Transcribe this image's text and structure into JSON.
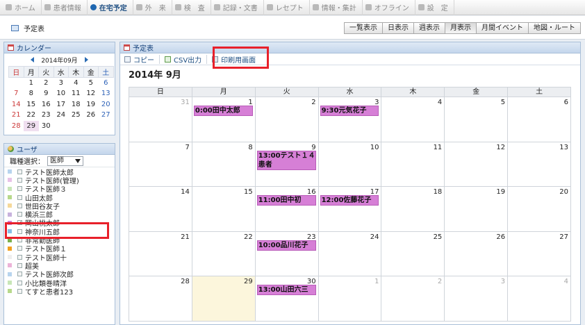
{
  "nav": [
    {
      "label": "ホーム",
      "icon": "home-icon",
      "active": false
    },
    {
      "label": "患者情報",
      "icon": "patient-icon",
      "active": false
    },
    {
      "label": "在宅予定",
      "icon": "clock-icon",
      "active": true
    },
    {
      "label": "外　来",
      "icon": "outpatient-icon",
      "active": false
    },
    {
      "label": "検　査",
      "icon": "test-icon",
      "active": false
    },
    {
      "label": "記録・文書",
      "icon": "document-icon",
      "active": false
    },
    {
      "label": "レセプト",
      "icon": "receipt-icon",
      "active": false
    },
    {
      "label": "情報・集計",
      "icon": "chart-icon",
      "active": false
    },
    {
      "label": "オフライン",
      "icon": "offline-icon",
      "active": false
    },
    {
      "label": "設　定",
      "icon": "settings-icon",
      "active": false
    }
  ],
  "page_title": "予定表",
  "view_buttons": [
    {
      "label": "一覧表示",
      "selected": false
    },
    {
      "label": "日表示",
      "selected": false
    },
    {
      "label": "週表示",
      "selected": false
    },
    {
      "label": "月表示",
      "selected": true
    },
    {
      "label": "月間イベント",
      "selected": false
    },
    {
      "label": "地図・ルート",
      "selected": false
    }
  ],
  "calendar_panel": {
    "title": "カレンダー",
    "month_label": "2014年09月",
    "weekdays": [
      "日",
      "月",
      "火",
      "水",
      "木",
      "金",
      "土"
    ],
    "weeks": [
      [
        "",
        "1",
        "2",
        "3",
        "4",
        "5",
        "6"
      ],
      [
        "7",
        "8",
        "9",
        "10",
        "11",
        "12",
        "13"
      ],
      [
        "14",
        "15",
        "16",
        "17",
        "18",
        "19",
        "20"
      ],
      [
        "21",
        "22",
        "23",
        "24",
        "25",
        "26",
        "27"
      ],
      [
        "28",
        "29",
        "30",
        "",
        "",
        "",
        ""
      ]
    ],
    "selected_day": "29"
  },
  "user_panel": {
    "title": "ユーザ",
    "filter_label": "職種選択：",
    "filter_value": "医師",
    "users": [
      {
        "name": "テスト医師太郎",
        "color": "#b8d4ee",
        "checked": false
      },
      {
        "name": "テスト医師(管理)",
        "color": "#e8c3e8",
        "checked": false
      },
      {
        "name": "テスト医師３",
        "color": "#c8e6b8",
        "checked": false
      },
      {
        "name": "山田太郎",
        "color": "#b7d98b",
        "checked": false
      },
      {
        "name": "世田谷友子",
        "color": "#f5d99a",
        "checked": false
      },
      {
        "name": "横浜三郎",
        "color": "#c7b2dd",
        "checked": false
      },
      {
        "name": "岡山桃太郎",
        "color": "#d67fd6",
        "checked": true
      },
      {
        "name": "神奈川五郎",
        "color": "#88bfe8",
        "checked": false
      },
      {
        "name": "非常勤医師",
        "color": "#7bb04d",
        "checked": false
      },
      {
        "name": "テスト医師１",
        "color": "#f2a020",
        "checked": false
      },
      {
        "name": "テスト医師十",
        "color": "#eeeeee",
        "checked": false
      },
      {
        "name": "超美",
        "color": "#ecb3d8",
        "checked": false
      },
      {
        "name": "テスト医師次郎",
        "color": "#b8d4ee",
        "checked": false
      },
      {
        "name": "小比類巻晴洋",
        "color": "#c8e6b8",
        "checked": false
      },
      {
        "name": "てすと患者123",
        "color": "#b7d98b",
        "checked": false
      }
    ]
  },
  "schedule_panel": {
    "title": "予定表",
    "toolbar": {
      "copy": "コピー",
      "csv": "CSV出力",
      "print": "印刷用画面"
    },
    "month_title": "2014年 9月",
    "weekdays": [
      "日",
      "月",
      "火",
      "水",
      "木",
      "金",
      "土"
    ],
    "weeks": [
      [
        {
          "d": "31",
          "other": true
        },
        {
          "d": "1",
          "ev": "0:00田中太郎"
        },
        {
          "d": "2"
        },
        {
          "d": "3",
          "ev": "9:30元気花子"
        },
        {
          "d": "4"
        },
        {
          "d": "5"
        },
        {
          "d": "6"
        }
      ],
      [
        {
          "d": "7"
        },
        {
          "d": "8"
        },
        {
          "d": "9",
          "ev": "13:00テスト１４患者"
        },
        {
          "d": "10"
        },
        {
          "d": "11"
        },
        {
          "d": "12"
        },
        {
          "d": "13"
        }
      ],
      [
        {
          "d": "14"
        },
        {
          "d": "15"
        },
        {
          "d": "16",
          "ev": "11:00田中初"
        },
        {
          "d": "17",
          "ev": "12:00佐藤花子"
        },
        {
          "d": "18"
        },
        {
          "d": "19"
        },
        {
          "d": "20"
        }
      ],
      [
        {
          "d": "21"
        },
        {
          "d": "22"
        },
        {
          "d": "23",
          "ev": "10:00品川花子"
        },
        {
          "d": "24"
        },
        {
          "d": "25"
        },
        {
          "d": "26"
        },
        {
          "d": "27"
        }
      ],
      [
        {
          "d": "28"
        },
        {
          "d": "29",
          "today": true
        },
        {
          "d": "30",
          "ev": "13:00山田六三"
        },
        {
          "d": "1",
          "other": true
        },
        {
          "d": "2",
          "other": true
        },
        {
          "d": "3",
          "other": true
        },
        {
          "d": "4",
          "other": true
        }
      ]
    ]
  }
}
